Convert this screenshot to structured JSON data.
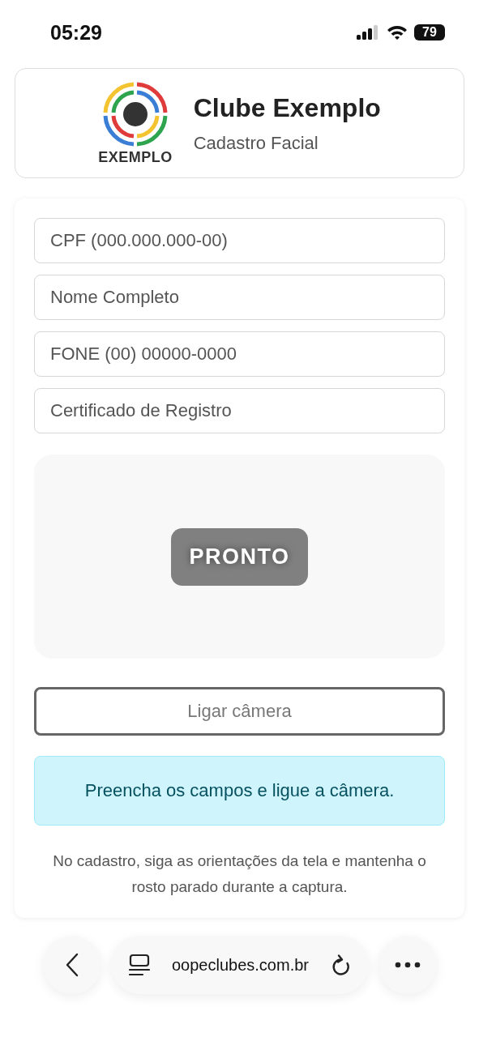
{
  "status_bar": {
    "time": "05:29",
    "battery": "79"
  },
  "header": {
    "logo_text": "EXEMPLO",
    "title": "Clube Exemplo",
    "subtitle": "Cadastro Facial"
  },
  "fields": [
    {
      "placeholder": "CPF (000.000.000-00)"
    },
    {
      "placeholder": "Nome Completo"
    },
    {
      "placeholder": "FONE (00) 00000-0000"
    },
    {
      "placeholder": "Certificado de Registro"
    }
  ],
  "camera": {
    "badge": "PRONTO"
  },
  "camera_button": {
    "label": "Ligar câmera",
    "disabled": true
  },
  "alert": {
    "text": "Preencha os campos e ligue a câmera."
  },
  "note": "No cadastro, siga as orientações da tela e mantenha o rosto parado durante a captura.",
  "browser_bar": {
    "url": "oopeclubes.com.br"
  }
}
